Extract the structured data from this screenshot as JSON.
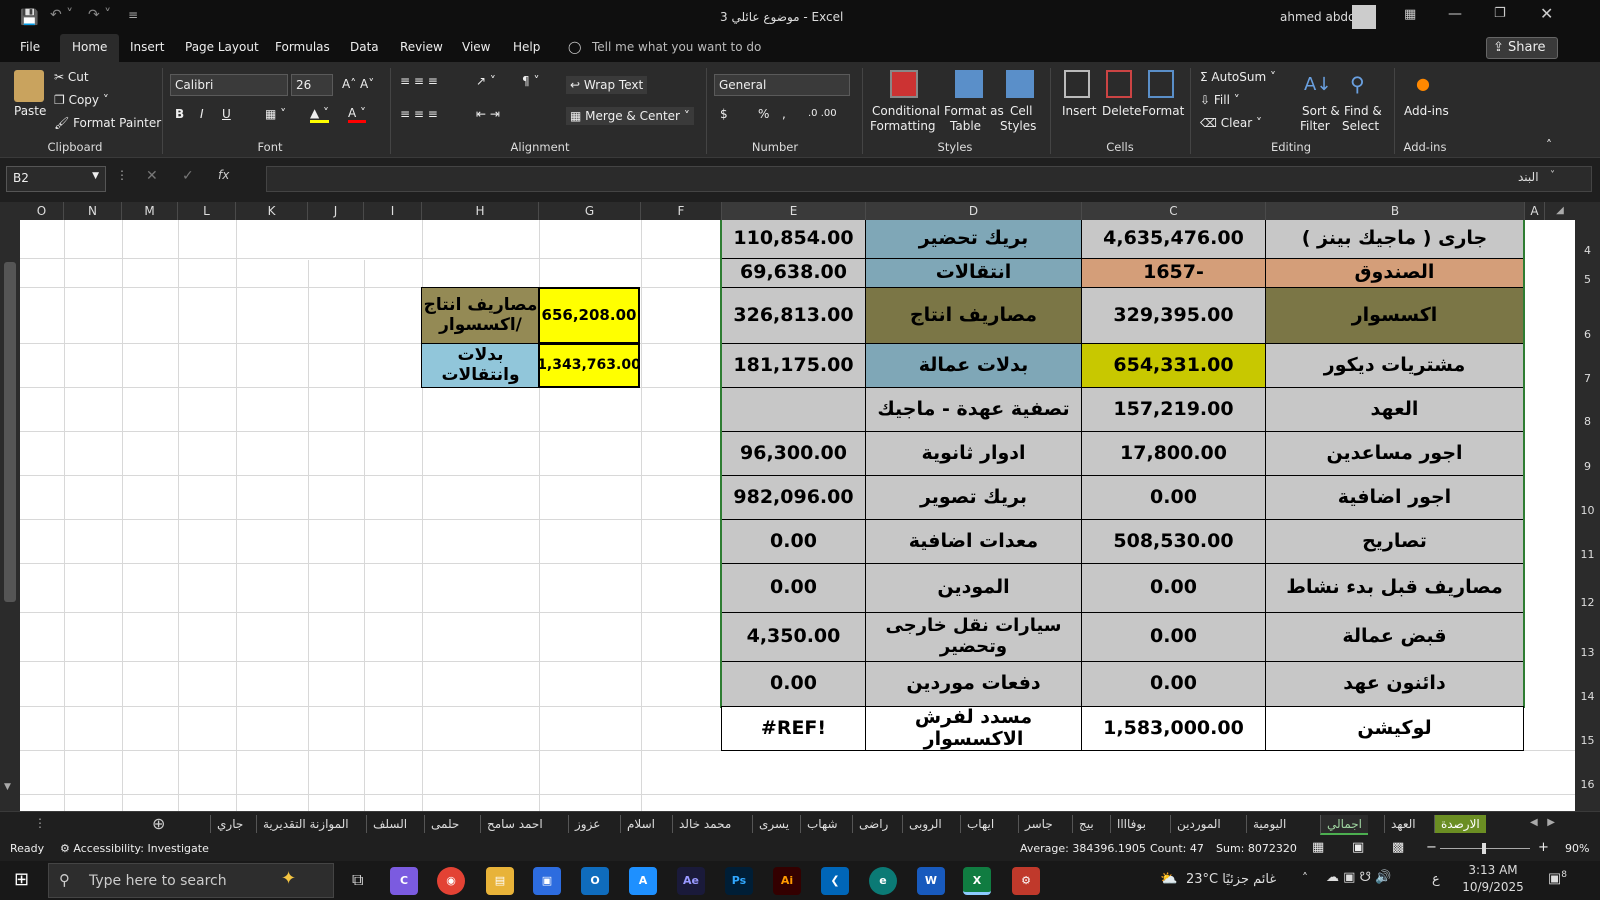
{
  "window": {
    "title": "موضوع عائلي 3  -  Excel",
    "user": "ahmed abdo",
    "share": "Share"
  },
  "menu": {
    "file": "File",
    "tabs": [
      "Home",
      "Insert",
      "Page Layout",
      "Formulas",
      "Data",
      "Review",
      "View",
      "Help"
    ],
    "tell_me": "Tell me what you want to do"
  },
  "ribbon": {
    "clipboard": {
      "paste": "Paste",
      "cut": "Cut",
      "copy": "Copy",
      "format_painter": "Format Painter",
      "label": "Clipboard"
    },
    "font": {
      "name": "Calibri",
      "size": "26",
      "bold": "B",
      "italic": "I",
      "underline": "U",
      "label": "Font"
    },
    "alignment": {
      "wrap": "Wrap Text",
      "merge": "Merge & Center",
      "label": "Alignment"
    },
    "number": {
      "format": "General",
      "currency": "$",
      "percent": "%",
      "comma": ",",
      "label": "Number"
    },
    "styles": {
      "conditional": "Conditional",
      "conditional2": "Formatting",
      "format_table": "Format as",
      "format_table2": "Table",
      "cell_styles": "Cell",
      "cell_styles2": "Styles",
      "label": "Styles"
    },
    "cells": {
      "insert": "Insert",
      "delete": "Delete",
      "format": "Format",
      "label": "Cells"
    },
    "editing": {
      "autosum": "AutoSum",
      "fill": "Fill",
      "clear": "Clear",
      "sort": "Sort &",
      "sort2": "Filter",
      "find": "Find &",
      "find2": "Select",
      "label": "Editing"
    },
    "addins": {
      "btn": "Add-ins",
      "label": "Add-ins"
    }
  },
  "formula_bar": {
    "name_box": "B2",
    "fx": "fx",
    "right_label": "البند"
  },
  "columns": [
    "O",
    "N",
    "M",
    "L",
    "K",
    "J",
    "I",
    "H",
    "G",
    "F",
    "E",
    "D",
    "C",
    "B",
    "A"
  ],
  "rows": [
    "4",
    "5",
    "6",
    "7",
    "8",
    "9",
    "10",
    "11",
    "12",
    "13",
    "14",
    "15",
    "16"
  ],
  "table": [
    [
      "110,854.00",
      "بريك تحضير",
      "4,635,476.00",
      "جارى ( ماجيك بينز )"
    ],
    [
      "69,638.00",
      "انتقالات",
      "1657-",
      "الصندوق"
    ],
    [
      "326,813.00",
      "مصاريف انتاج",
      "329,395.00",
      "اكسسوار"
    ],
    [
      "181,175.00",
      "بدلات عمالة",
      "654,331.00",
      "مشتريات ديكور"
    ],
    [
      "",
      "تصفية عهدة - ماجيك",
      "157,219.00",
      "العهد"
    ],
    [
      "96,300.00",
      "ادوار ثانوية",
      "17,800.00",
      "اجور مساعدين"
    ],
    [
      "982,096.00",
      "بريك تصوير",
      "0.00",
      "اجور اضافية"
    ],
    [
      "0.00",
      "معدات اضافية",
      "508,530.00",
      "تصاريح"
    ],
    [
      "0.00",
      "المودين",
      "0.00",
      "مصاريف قبل بدء نشاط"
    ],
    [
      "4,350.00",
      "سيارات نقل خارجى وتحضير",
      "0.00",
      "قبض عمالة"
    ],
    [
      "0.00",
      "دفعات موردين",
      "0.00",
      "دائنون عهد"
    ],
    [
      "#REF!",
      "مسدد لفرش الاكسسوار",
      "1,583,000.00",
      "لوكيشن"
    ]
  ],
  "side_table": [
    [
      "مصاريف انتاج /اكسسوار",
      "656,208.00"
    ],
    [
      "بدلات وانتقالات",
      "1,343,763.00"
    ]
  ],
  "sheet_tabs": [
    "جاري",
    "الموازنة التقديرية",
    "السلف",
    "حلمى",
    "احمد سامح",
    "عزوز",
    "اسلام",
    "محمد خالد",
    "يسرى",
    "شهاب",
    "راضى",
    "الروبى",
    "ايهاب",
    "جاسر",
    "بيج",
    "بوفاااا",
    "الموردين",
    "اليومية",
    "اجمالي",
    "العهد",
    "الارصدة"
  ],
  "status": {
    "ready": "Ready",
    "accessibility": "Accessibility: Investigate",
    "average": "Average: 384396.1905",
    "count": "Count: 47",
    "sum": "Sum: 8072320",
    "zoom": "90%"
  },
  "taskbar": {
    "search": "Type here to search",
    "weather": "23°C  غائم جزئيًا",
    "lang": "ع",
    "time": "3:13 AM",
    "date": "10/9/2025",
    "notif": "8"
  }
}
